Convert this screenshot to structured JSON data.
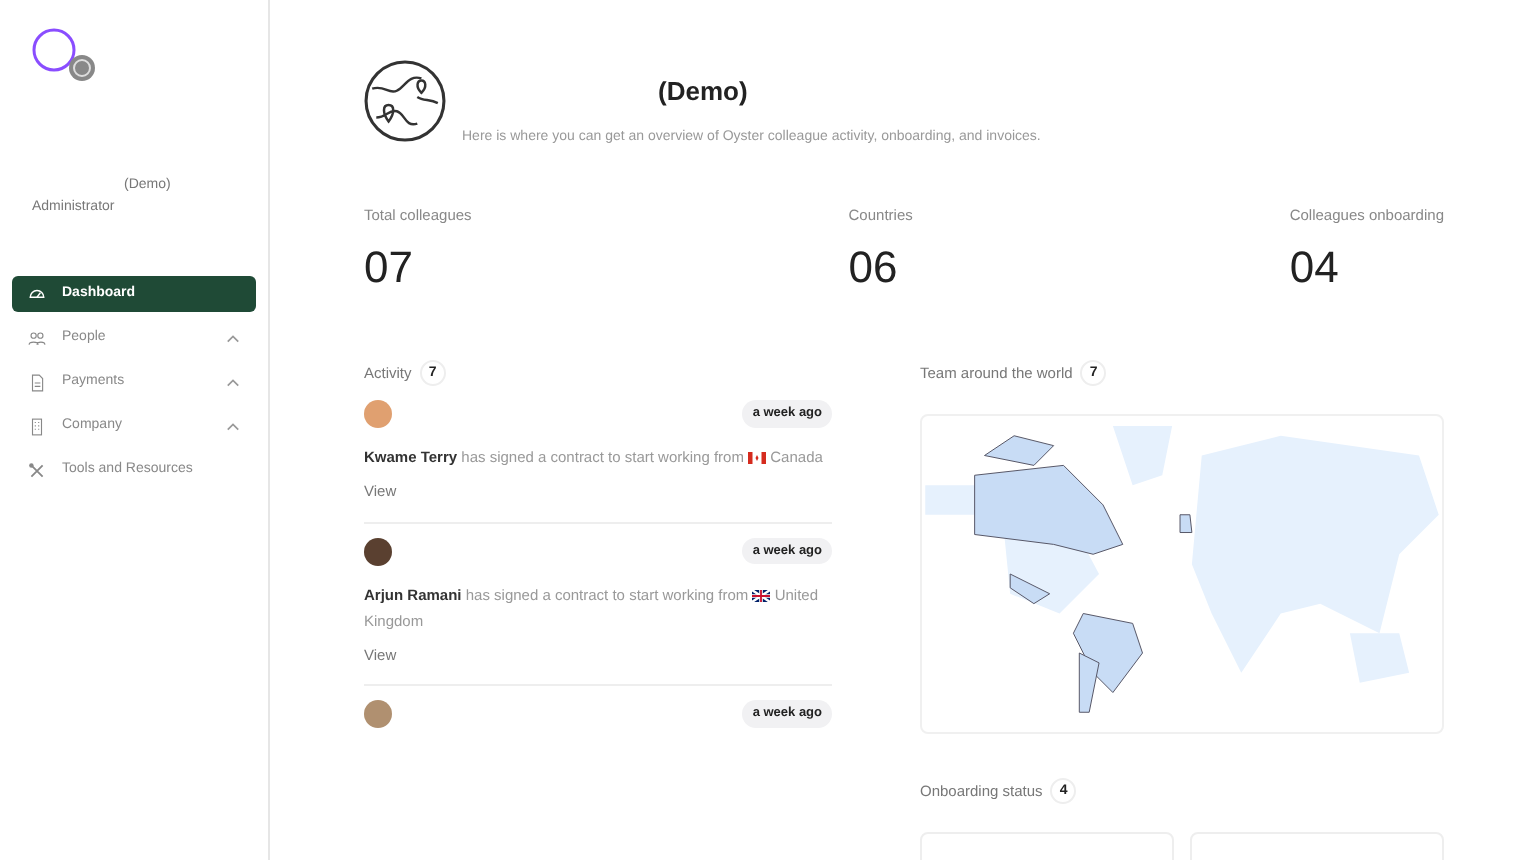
{
  "sidebar": {
    "company": "(Demo)",
    "role": "Administrator",
    "items": [
      {
        "label": "Dashboard",
        "selected": true,
        "expandable": false
      },
      {
        "label": "People",
        "selected": false,
        "expandable": true
      },
      {
        "label": "Payments",
        "selected": false,
        "expandable": true
      },
      {
        "label": "Company",
        "selected": false,
        "expandable": true
      },
      {
        "label": "Tools and Resources",
        "selected": false,
        "expandable": false
      }
    ]
  },
  "header": {
    "title": "(Demo)",
    "subtitle": "Here is where you can get an overview of Oyster colleague activity, onboarding, and invoices."
  },
  "stats": [
    {
      "label": "Total colleagues",
      "value": "07"
    },
    {
      "label": "Countries",
      "value": "06"
    },
    {
      "label": "Colleagues onboarding",
      "value": "04"
    }
  ],
  "activity": {
    "title": "Activity",
    "count": "7",
    "items": [
      {
        "time": "a week ago",
        "name": "Kwame Terry",
        "text": "has signed a contract to start working from",
        "country": "Canada",
        "link": "View"
      },
      {
        "time": "a week ago",
        "name": "Arjun Ramani",
        "text": "has signed a contract to start working from",
        "country": "United Kingdom",
        "link": "View"
      },
      {
        "time": "a week ago"
      }
    ]
  },
  "team": {
    "title": "Team around the world",
    "count": "7"
  },
  "onboarding": {
    "title": "Onboarding status",
    "count": "4"
  }
}
